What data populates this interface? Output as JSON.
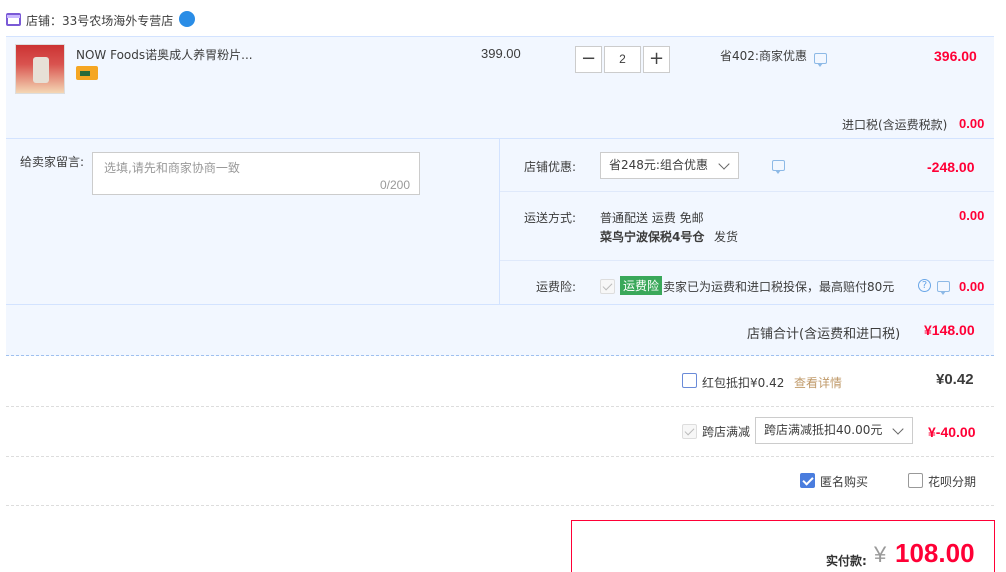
{
  "shop": {
    "label": "店铺：",
    "name": "33号农场海外专营店"
  },
  "item": {
    "title": "NOW Foods诺奥成人养胃粉片...",
    "unit_price": "399.00",
    "quantity": "2",
    "discount": "省402:商家优惠",
    "subtotal": "396.00",
    "import_tax_label": "进口税(含运费税款)",
    "import_tax_value": "0.00"
  },
  "message": {
    "label": "给卖家留言:",
    "placeholder": "选填,请先和商家协商一致",
    "counter": "0/200"
  },
  "store_discount": {
    "label": "店铺优惠:",
    "selected": "省248元:组合优惠",
    "value": "-248.00"
  },
  "shipping": {
    "label": "运送方式:",
    "method": "普通配送 运费 免邮",
    "warehouse": "菜鸟宁波保税4号仓",
    "ship_note": "发货",
    "value": "0.00"
  },
  "insurance": {
    "label": "运费险:",
    "tag": "运费险",
    "desc": "卖家已为运费和进口税投保，最高赔付80元",
    "value": "0.00"
  },
  "store_total": {
    "label": "店铺合计(含运费和进口税)",
    "value": "¥148.00"
  },
  "red_packet": {
    "label": "红包抵扣¥0.42",
    "link": "查看详情",
    "value": "¥0.42"
  },
  "cross_store": {
    "label": "跨店满减",
    "selected": "跨店满减抵扣40.00元",
    "value": "¥-40.00"
  },
  "options": {
    "anonymous": "匿名购买",
    "installment": "花呗分期"
  },
  "payment": {
    "label": "实付款:",
    "currency": "¥",
    "amount": "108.00"
  },
  "colors": {
    "accent_red": "#ff0036",
    "panel_blue": "#f2f7ff",
    "border_blue": "#b2d1ff",
    "tag_green": "#3aa85a"
  }
}
